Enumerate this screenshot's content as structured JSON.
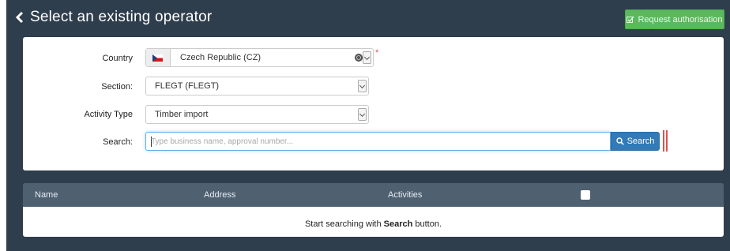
{
  "header": {
    "title": "Select an existing operator",
    "request_button_label": "Request authorisation"
  },
  "form": {
    "country": {
      "label": "Country",
      "value": "Czech Republic (CZ)",
      "required_mark": "*"
    },
    "section": {
      "label": "Section:",
      "value": "FLEGT (FLEGT)"
    },
    "activity_type": {
      "label": "Activity Type",
      "value": "Timber import"
    },
    "search": {
      "label": "Search:",
      "placeholder": "Type business name, approval number...",
      "button_label": "Search"
    }
  },
  "table": {
    "columns": [
      "Name",
      "Address",
      "Activities"
    ],
    "empty_message_prefix": "Start searching with ",
    "empty_message_bold": "Search",
    "empty_message_suffix": " button."
  },
  "colors": {
    "background": "#2f3e4d",
    "primary": "#337ab7",
    "success": "#5cb85c",
    "table_header": "#4f6071",
    "required": "#d9534f"
  },
  "icons": {
    "back": "chevron-left-icon",
    "request": "edit-check-icon",
    "flag": "czech-flag-icon",
    "globe": "globe-icon",
    "search": "search-icon"
  }
}
